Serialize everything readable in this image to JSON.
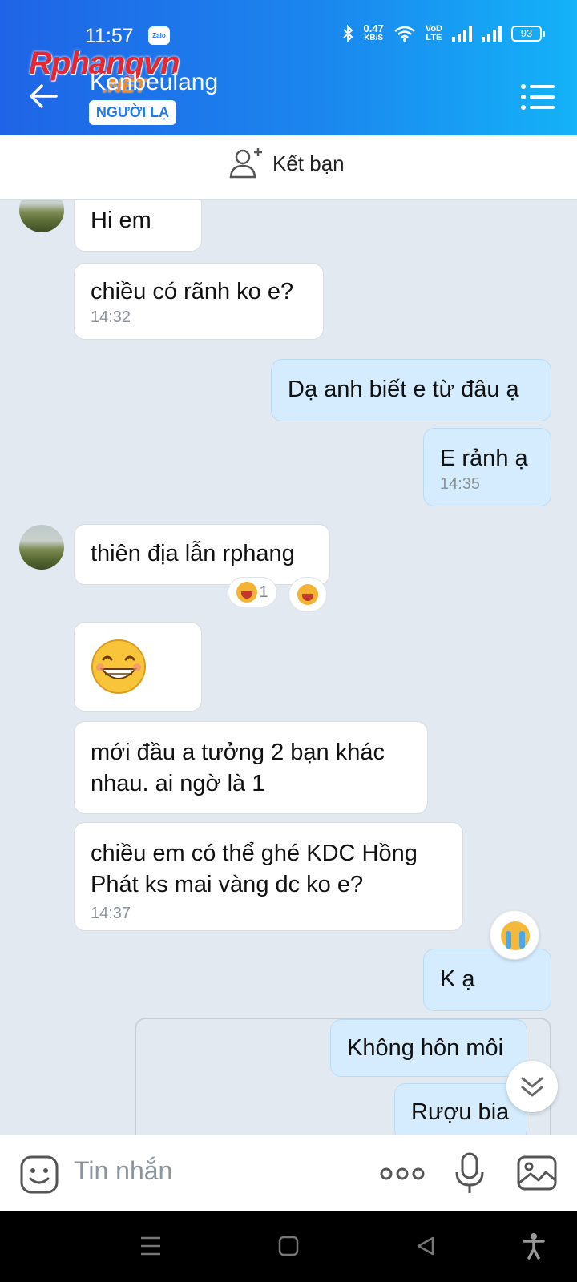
{
  "status_bar": {
    "time": "11:57",
    "app_badge": "Zalo",
    "net_speed_value": "0.47",
    "net_speed_unit": "KB/S",
    "volte_top": "VoD",
    "volte_bottom": "LTE",
    "battery": "93"
  },
  "watermark": {
    "main": "Rphangvn",
    "sub": ".NET"
  },
  "header": {
    "contact_name": "Kenbeulang",
    "stranger_badge": "NGƯỜI LẠ",
    "back_icon": "arrow-left-icon",
    "menu_icon": "list-menu-icon"
  },
  "friend_bar": {
    "label": "Kết bạn",
    "icon": "add-user-icon"
  },
  "messages": [
    {
      "dir": "in",
      "text": "Hi em"
    },
    {
      "dir": "in",
      "text": "chiều có rãnh ko e?",
      "time": "14:32"
    },
    {
      "dir": "out",
      "text": "Dạ anh biết e từ đâu ạ"
    },
    {
      "dir": "out",
      "text": "E rảnh ạ",
      "time": "14:35"
    },
    {
      "dir": "in",
      "text": "thiên địa lẫn rphang",
      "reaction_count": "1"
    },
    {
      "dir": "in",
      "sticker": "grin-emoji"
    },
    {
      "dir": "in",
      "text_line1": "mới đầu a tưởng 2 bạn khác",
      "text_line2": "nhau. ai ngờ là 1"
    },
    {
      "dir": "in",
      "text_line1": "chiều em có thể ghé KDC Hồng",
      "text_line2": "Phát ks mai vàng dc ko e?",
      "time": "14:37"
    },
    {
      "dir": "out",
      "text": "K ạ",
      "reaction": "crying-emoji"
    },
    {
      "dir": "out",
      "text": "Không hôn môi"
    },
    {
      "dir": "out",
      "text": "Rượu bia"
    }
  ],
  "input_bar": {
    "placeholder": "Tin nhắn",
    "emoji_icon": "sticker-smile-icon",
    "more_icon": "more-dots-icon",
    "mic_icon": "microphone-icon",
    "image_icon": "image-icon"
  },
  "colors": {
    "header_start": "#1f64e6",
    "header_end": "#14b2f8",
    "chat_bg": "#e2e9f1",
    "out_bubble": "#d4ecfd",
    "in_bubble": "#ffffff"
  }
}
